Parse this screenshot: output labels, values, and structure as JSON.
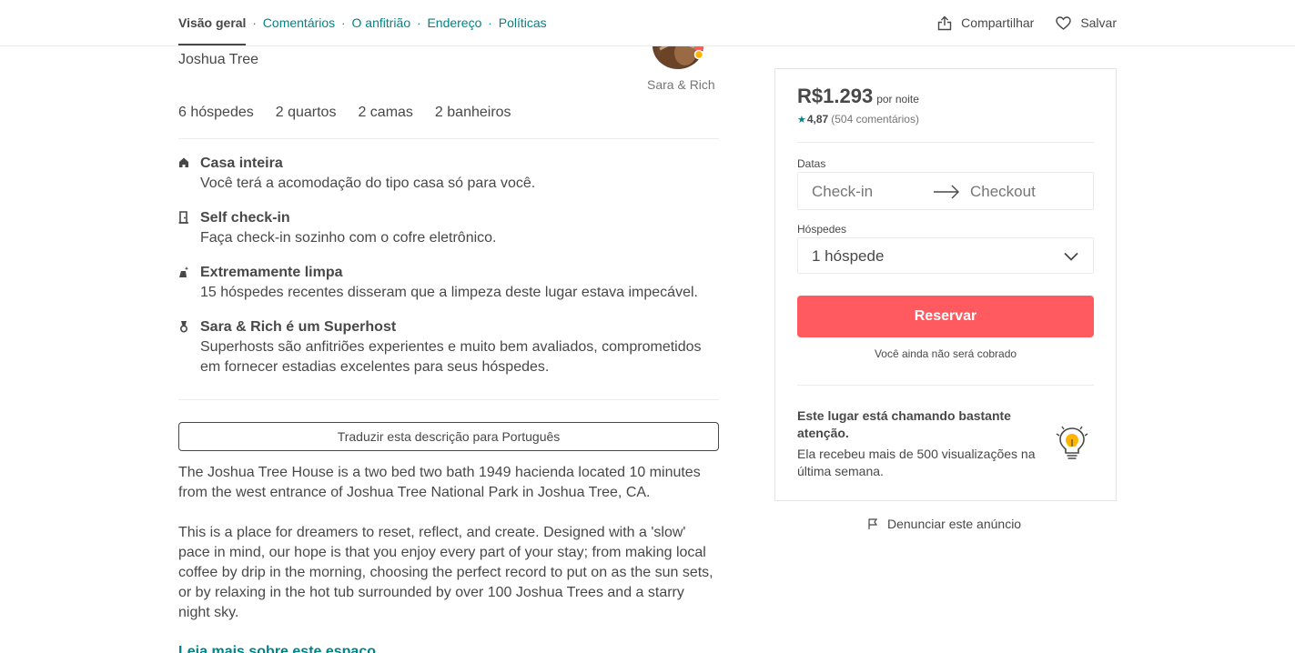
{
  "nav": {
    "tabs": [
      {
        "label": "Visão geral"
      },
      {
        "label": "Comentários"
      },
      {
        "label": "O anfitrião"
      },
      {
        "label": "Endereço"
      },
      {
        "label": "Políticas"
      }
    ],
    "separator": "·",
    "share_label": "Compartilhar",
    "save_label": "Salvar"
  },
  "listing": {
    "location": "Joshua Tree",
    "host_name": "Sara & Rich",
    "stats": [
      "6 hóspedes",
      "2 quartos",
      "2 camas",
      "2 banheiros"
    ],
    "features": [
      {
        "icon": "home-icon",
        "title": "Casa inteira",
        "desc": "Você terá a acomodação do tipo casa só para você."
      },
      {
        "icon": "door-icon",
        "title": "Self check-in",
        "desc": "Faça check-in sozinho com o cofre eletrônico."
      },
      {
        "icon": "sparkle-icon",
        "title": "Extremamente limpa",
        "desc": "15 hóspedes recentes disseram que a limpeza deste lugar estava impecável."
      },
      {
        "icon": "medal-icon",
        "title": "Sara & Rich é um Superhost",
        "desc": "Superhosts são anfitriões experientes e muito bem avaliados, comprometidos em fornecer estadias excelentes para seus hóspedes."
      }
    ],
    "translate_label": "Traduzir esta descrição para Português",
    "description": [
      "The Joshua Tree House is a two bed two bath 1949 hacienda located 10 minutes from the west entrance of Joshua Tree National Park in Joshua Tree, CA.",
      "This is a place for dreamers to reset, reflect, and create. Designed with a 'slow' pace in mind, our hope is that you enjoy every part of your stay; from making local coffee by drip in the morning, choosing the perfect record to put on as the sun sets, or by relaxing in the hot tub surrounded by over 100 Joshua Trees and a starry night sky."
    ],
    "read_more": "Leia mais sobre este espaço"
  },
  "booking": {
    "price": "R$1.293",
    "per_night": "por noite",
    "star": "★",
    "rating": "4,87",
    "reviews": "(504 comentários)",
    "dates_label": "Datas",
    "checkin": "Check-in",
    "checkout": "Checkout",
    "guests_label": "Hóspedes",
    "guests_value": "1 hóspede",
    "reserve_label": "Reservar",
    "no_charge": "Você ainda não será cobrado",
    "attention_title": "Este lugar está chamando bastante atenção.",
    "attention_desc": "Ela recebeu mais de 500 visualizações na última semana.",
    "report_label": "Denunciar este anúncio"
  },
  "colors": {
    "accent": "#008489",
    "brand": "#ff5a5f",
    "text": "#484848",
    "muted": "#767676",
    "border": "#ebebeb"
  }
}
